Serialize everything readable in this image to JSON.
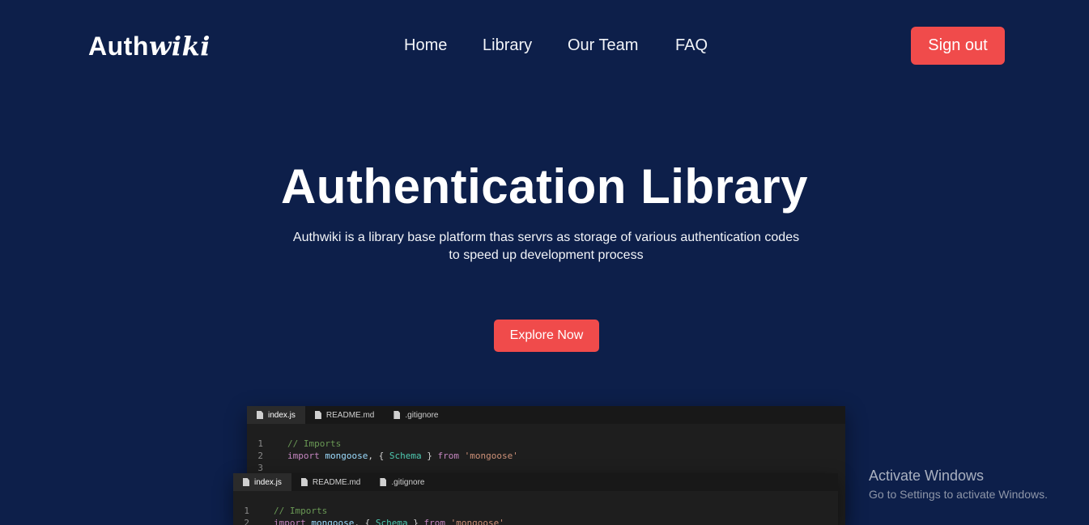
{
  "header": {
    "logo_main": "Auth",
    "logo_script": "wiki",
    "nav": [
      "Home",
      "Library",
      "Our Team",
      "FAQ"
    ],
    "signout_label": "Sign out"
  },
  "hero": {
    "title": "Authentication Library",
    "subtitle_line1": "Authwiki is a library base platform thas servrs as storage of various authentication codes",
    "subtitle_line2": "to speed up development process",
    "cta_label": "Explore Now"
  },
  "editor_back": {
    "tabs": [
      "index.js",
      "README.md",
      ".gitignore"
    ],
    "lines": [
      {
        "n": "1",
        "comment": "// Imports"
      },
      {
        "n": "2",
        "kw": "import",
        "id": "mongoose",
        "p1": ", { ",
        "type": "Schema",
        "p2": " } ",
        "kw2": "from",
        "str": "'mongoose'"
      },
      {
        "n": "3"
      }
    ]
  },
  "editor_front": {
    "tabs": [
      "index.js",
      "README.md",
      ".gitignore"
    ],
    "lines": [
      {
        "n": "1",
        "comment": "// Imports"
      },
      {
        "n": "2",
        "kw": "import",
        "id": "mongoose",
        "p1": ", { ",
        "type": "Schema",
        "p2": " } ",
        "kw2": "from",
        "str": "'mongoose'"
      }
    ]
  },
  "watermark": {
    "title": "Activate Windows",
    "subtitle": "Go to Settings to activate Windows."
  },
  "colors": {
    "background": "#0d1f4a",
    "accent": "#f04b4b"
  }
}
